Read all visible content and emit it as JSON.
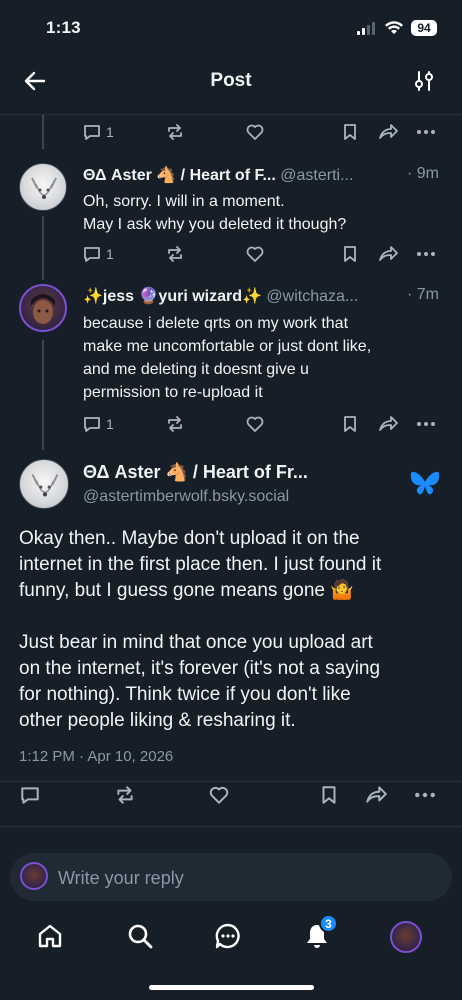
{
  "status_bar": {
    "time": "1:13",
    "battery": "94"
  },
  "header": {
    "title": "Post"
  },
  "parent_actions": {
    "replies": "1"
  },
  "posts": [
    {
      "name": "ΘΔ Aster 🐴 / Heart of F...",
      "handle": "@asterti...",
      "time": "· 9m",
      "lines": [
        "Oh, sorry. I will in a moment.",
        "May I ask why you deleted it though?"
      ],
      "replies": "1"
    },
    {
      "name": "✨jess 🔮yuri wizard✨",
      "handle": "@witchaza...",
      "time": "· 7m",
      "lines": [
        "because i delete qrts on my work that",
        "make me uncomfortable or just dont like,",
        "and me deleting it doesnt give u",
        "permission to re-upload it"
      ],
      "replies": "1"
    }
  ],
  "main_post": {
    "name": "ΘΔ Aster 🐴 / Heart of Fr...",
    "handle": "@astertimberwolf.bsky.social",
    "lines": [
      "Okay then.. Maybe don't upload it on the",
      "internet in the first place then. I just found it",
      "funny, but I guess gone means gone 🤷",
      "",
      "Just bear in mind that once you upload art",
      "on the internet, it's forever (it's not a saying",
      "for nothing). Think twice if you don't like",
      "other people liking & resharing it."
    ],
    "timestamp": "1:12 PM · Apr 10, 2026"
  },
  "reply_box": {
    "placeholder": "Write your reply"
  },
  "bottom_nav": {
    "notifications_count": "3"
  },
  "colors": {
    "background": "#161e27",
    "accent": "#1a8cff",
    "muted": "#8b98a5"
  },
  "icons": [
    "back-arrow-icon",
    "filter-sliders-icon",
    "reply-icon",
    "repost-icon",
    "like-icon",
    "bookmark-icon",
    "share-icon",
    "more-icon",
    "bluesky-butterfly-icon",
    "home-icon",
    "search-icon",
    "chat-icon",
    "bell-icon"
  ]
}
